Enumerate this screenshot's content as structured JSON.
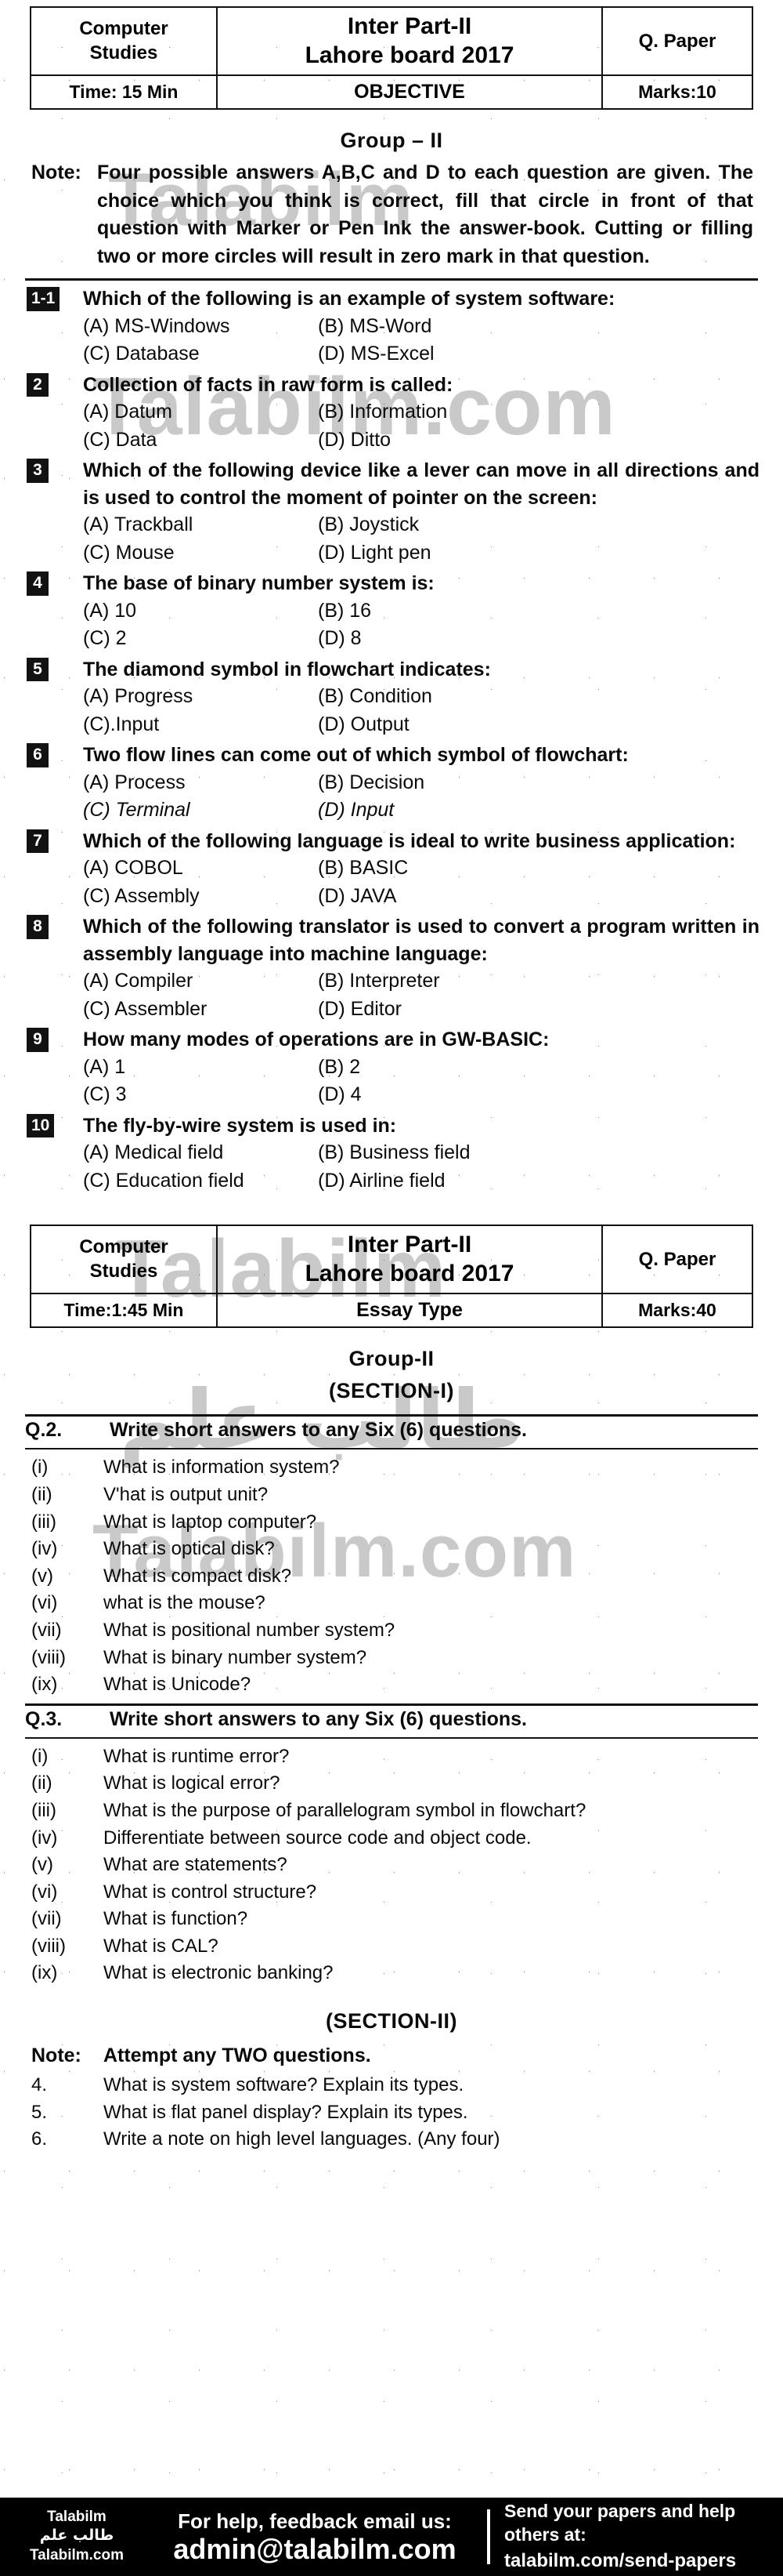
{
  "objective_header": {
    "subject": "Computer\nStudies",
    "title_line1": "Inter Part-II",
    "title_line2": "Lahore board 2017",
    "paper_kind": "Q. Paper",
    "time": "Time: 15 Min",
    "type": "OBJECTIVE",
    "marks": "Marks:10"
  },
  "objective_group_heading": "Group – II",
  "objective_note": {
    "label": "Note:",
    "text": "Four possible answers A,B,C and D to each question are given. The choice which you think is correct, fill that circle in front of that question with Marker or Pen Ink the answer-book. Cutting or filling two or more circles will result in zero mark in that question."
  },
  "mcqs": [
    {
      "number": "1-1",
      "stem": "Which of the following is an example of system software:",
      "options": [
        "(A) MS-Windows",
        "(B) MS-Word",
        "(C) Database",
        "(D) MS-Excel"
      ]
    },
    {
      "number": "2",
      "stem": "Collection of facts in raw form is called:",
      "options": [
        "(A) Datum",
        "(B) Information",
        "(C) Data",
        "(D) Ditto"
      ]
    },
    {
      "number": "3",
      "stem": "Which of the following device like a lever can move in all directions and is used to control the moment of pointer on the screen:",
      "options": [
        "(A) Trackball",
        "(B) Joystick",
        "(C) Mouse",
        "(D) Light pen"
      ]
    },
    {
      "number": "4",
      "stem": "The base of binary number system is:",
      "options": [
        "(A) 10",
        "(B) 16",
        "(C) 2",
        "(D) 8"
      ]
    },
    {
      "number": "5",
      "stem": "The diamond symbol in flowchart indicates:",
      "options": [
        "(A) Progress",
        "(B) Condition",
        "(C).Input",
        "(D) Output"
      ]
    },
    {
      "number": "6",
      "stem": "Two flow lines can come out of which symbol of flowchart:",
      "options": [
        "(A) Process",
        "(B) Decision",
        "(C) Terminal",
        "(D) Input"
      ],
      "italic_options": [
        2,
        3
      ]
    },
    {
      "number": "7",
      "stem": "Which of the following language is ideal to write business application:",
      "options": [
        "(A) COBOL",
        "(B) BASIC",
        "(C) Assembly",
        "(D) JAVA"
      ]
    },
    {
      "number": "8",
      "stem": "Which of the following translator is used to convert a program written in assembly language into machine language:",
      "options": [
        "(A) Compiler",
        "(B) Interpreter",
        "(C) Assembler",
        "(D) Editor"
      ]
    },
    {
      "number": "9",
      "stem": "How many modes of operations are in GW-BASIC:",
      "options": [
        "(A) 1",
        "(B) 2",
        "(C) 3",
        "(D) 4"
      ]
    },
    {
      "number": "10",
      "stem": "The fly-by-wire system is used in:",
      "options": [
        "(A) Medical field",
        "(B) Business field",
        "(C) Education field",
        "(D) Airline field"
      ]
    }
  ],
  "essay_header": {
    "subject": "Computer\nStudies",
    "title_line1": "Inter Part-II",
    "title_line2": "Lahore board 2017",
    "paper_kind": "Q. Paper",
    "time": "Time:1:45 Min",
    "type": "Essay Type",
    "marks": "Marks:40"
  },
  "essay_group_heading": "Group-II",
  "section_1_heading": "(SECTION-I)",
  "q2": {
    "label": "Q.2.",
    "instruction": "Write short answers to any Six (6) questions.",
    "items": [
      {
        "num": "(i)",
        "text": "What is information system?"
      },
      {
        "num": "(ii)",
        "text": "V'hat is output unit?"
      },
      {
        "num": "(iii)",
        "text": "What is laptop computer?"
      },
      {
        "num": "(iv)",
        "text": "What is optical disk?"
      },
      {
        "num": "(v)",
        "text": "What is compact disk?"
      },
      {
        "num": "(vi)",
        "text": "what is the mouse?"
      },
      {
        "num": "(vii)",
        "text": "What is positional number system?"
      },
      {
        "num": "(viii)",
        "text": "What is binary number system?"
      },
      {
        "num": "(ix)",
        "text": "What is Unicode?"
      }
    ]
  },
  "q3": {
    "label": "Q.3.",
    "instruction": "Write short answers to any Six (6) questions.",
    "items": [
      {
        "num": "(i)",
        "text": "What is runtime error?"
      },
      {
        "num": "(ii)",
        "text": "What is logical error?"
      },
      {
        "num": "(iii)",
        "text": "What is the purpose of parallelogram symbol in flowchart?"
      },
      {
        "num": "(iv)",
        "text": "Differentiate between source code and object code."
      },
      {
        "num": "(v)",
        "text": "What are statements?"
      },
      {
        "num": "(vi)",
        "text": "What is control structure?"
      },
      {
        "num": "(vii)",
        "text": "What is function?"
      },
      {
        "num": "(viii)",
        "text": "What is CAL?"
      },
      {
        "num": "(ix)",
        "text": "What is electronic banking?"
      }
    ]
  },
  "section_2_heading": "(SECTION-II)",
  "section_2_note": {
    "label": "Note:",
    "text": "Attempt any TWO questions."
  },
  "section_2_items": [
    {
      "num": "4.",
      "text": "What is system software? Explain its types."
    },
    {
      "num": "5.",
      "text": "What is flat panel display? Explain its types."
    },
    {
      "num": "6.",
      "text": "Write a note on high level languages. (Any four)"
    }
  ],
  "watermarks": {
    "w1": "Talabilm",
    "w2": "Talabilm.com",
    "w3": "Talabilm",
    "w4": "طالب علم",
    "w5": "Talabilm.com"
  },
  "footer": {
    "logo_line1": "Talabilm",
    "logo_line2": "طالب علم",
    "logo_line3": "Talabilm.com",
    "help_line1": "For help, feedback email us:",
    "help_email": "admin@talabilm.com",
    "send_line1": "Send your papers and help others at:",
    "send_url": "talabilm.com/send-papers"
  }
}
